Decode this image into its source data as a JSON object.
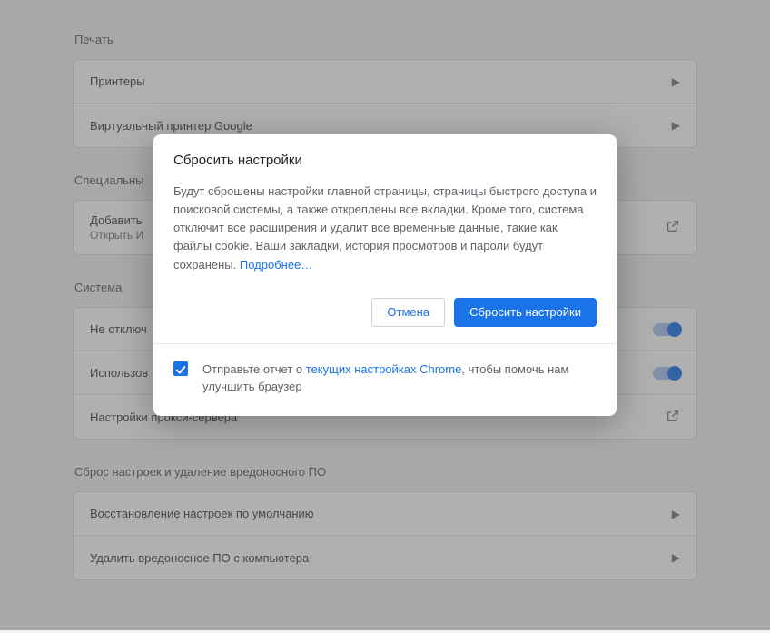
{
  "sections": {
    "print": {
      "title": "Печать",
      "rows": [
        {
          "label": "Принтеры"
        },
        {
          "label": "Виртуальный принтер Google"
        }
      ]
    },
    "accessibility": {
      "title": "Специальны",
      "row": {
        "label": "Добавить",
        "sub": "Открыть И"
      }
    },
    "system": {
      "title": "Система",
      "rows": [
        {
          "label": "Не отключ"
        },
        {
          "label": "Использов"
        },
        {
          "label": "Настройки прокси-сервера"
        }
      ]
    },
    "reset": {
      "title": "Сброс настроек и удаление вредоносного ПО",
      "rows": [
        {
          "label": "Восстановление настроек по умолчанию"
        },
        {
          "label": "Удалить вредоносное ПО с компьютера"
        }
      ]
    }
  },
  "dialog": {
    "title": "Сбросить настройки",
    "text_before_link": "Будут сброшены настройки главной страницы, страницы быстрого доступа и поисковой системы, а также откреплены все вкладки. Кроме того, система отключит все расширения и удалит все временные данные, такие как файлы cookie. Ваши закладки, история просмотров и пароли будут сохранены. ",
    "learn_more": "Подробнее…",
    "cancel": "Отмена",
    "confirm": "Сбросить настройки",
    "report_prefix": "Отправьте отчет о ",
    "report_link": "текущих настройках Chrome",
    "report_suffix": ", чтобы помочь нам улучшить браузер"
  }
}
